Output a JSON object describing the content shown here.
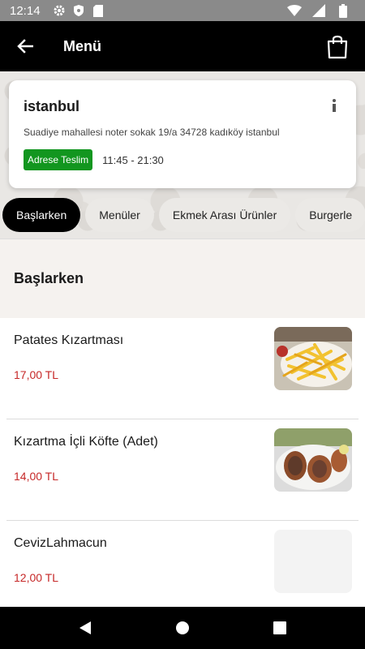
{
  "status_bar": {
    "time": "12:14"
  },
  "app_bar": {
    "title": "Menü"
  },
  "store": {
    "city": "istanbul",
    "address": "Suadiye mahallesi noter sokak 19/a 34728 kadıköy istanbul",
    "delivery_badge": "Adrese Teslim",
    "hours": "11:45 - 21:30"
  },
  "tabs": [
    {
      "label": "Başlarken",
      "active": true
    },
    {
      "label": "Menüler",
      "active": false
    },
    {
      "label": "Ekmek Arası Ürünler",
      "active": false
    },
    {
      "label": "Burgerle",
      "active": false
    }
  ],
  "section": {
    "title": "Başlarken"
  },
  "items": [
    {
      "name": "Patates  Kızartması",
      "price": "17,00 TL",
      "image": "fries"
    },
    {
      "name": "Kızartma İçli Köfte (Adet)",
      "price": "14,00 TL",
      "image": "kofte"
    },
    {
      "name": "CevizLahmacun",
      "price": "12,00 TL",
      "image": "none"
    }
  ],
  "colors": {
    "accent_green": "#12961f",
    "price_red": "#c62828",
    "app_bar": "#000000"
  }
}
